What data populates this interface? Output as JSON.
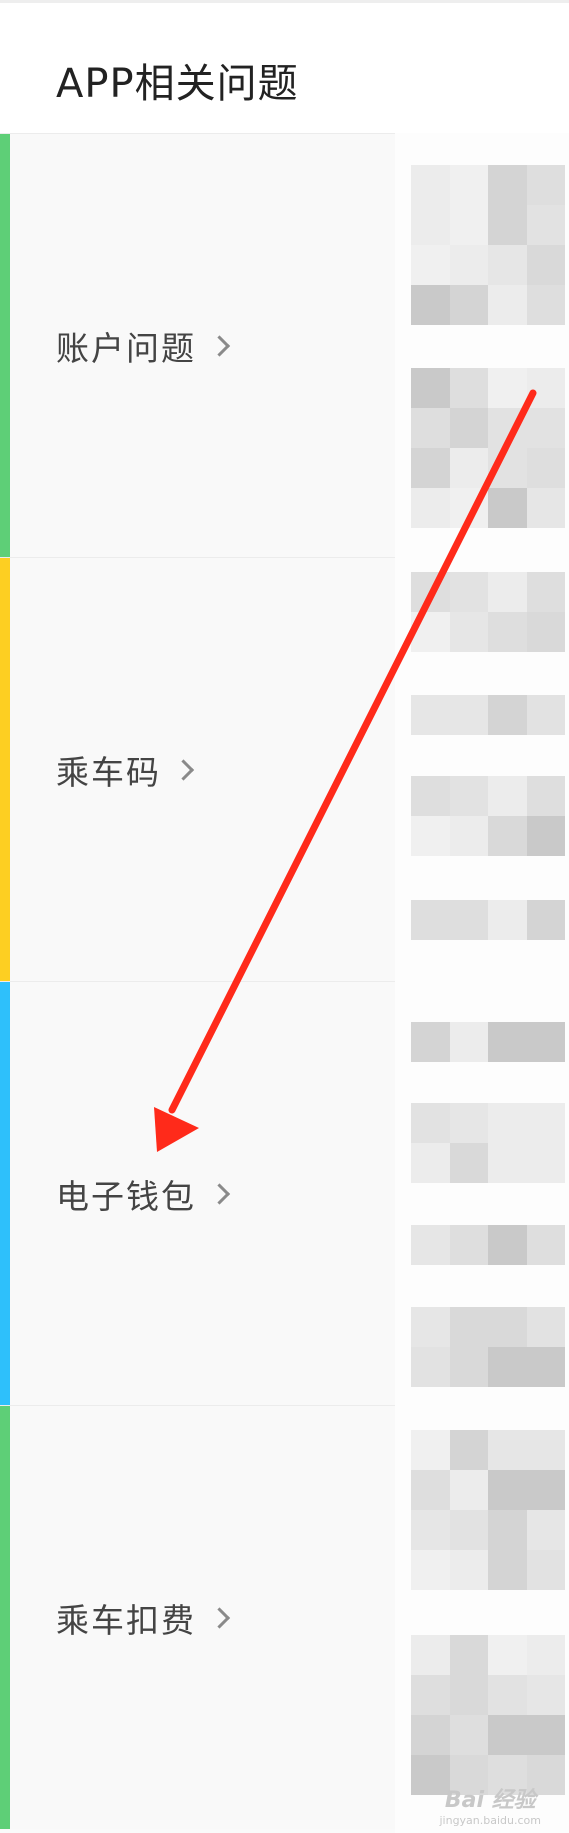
{
  "header": {
    "title": "APP相关问题"
  },
  "categories": [
    {
      "label": "账户问题",
      "accent": "#5ecf77"
    },
    {
      "label": "乘车码",
      "accent": "#fdcf22"
    },
    {
      "label": "电子钱包",
      "accent": "#2ec0fb"
    },
    {
      "label": "乘车扣费",
      "accent": "#5ecf77"
    }
  ],
  "icons": {
    "chevron": "chevron-right-icon",
    "annotation": "red-arrow"
  },
  "annotation": {
    "color": "#ff2a1a"
  },
  "watermark": {
    "main": "Bai 经验",
    "sub": "jingyan.baidu.com"
  }
}
